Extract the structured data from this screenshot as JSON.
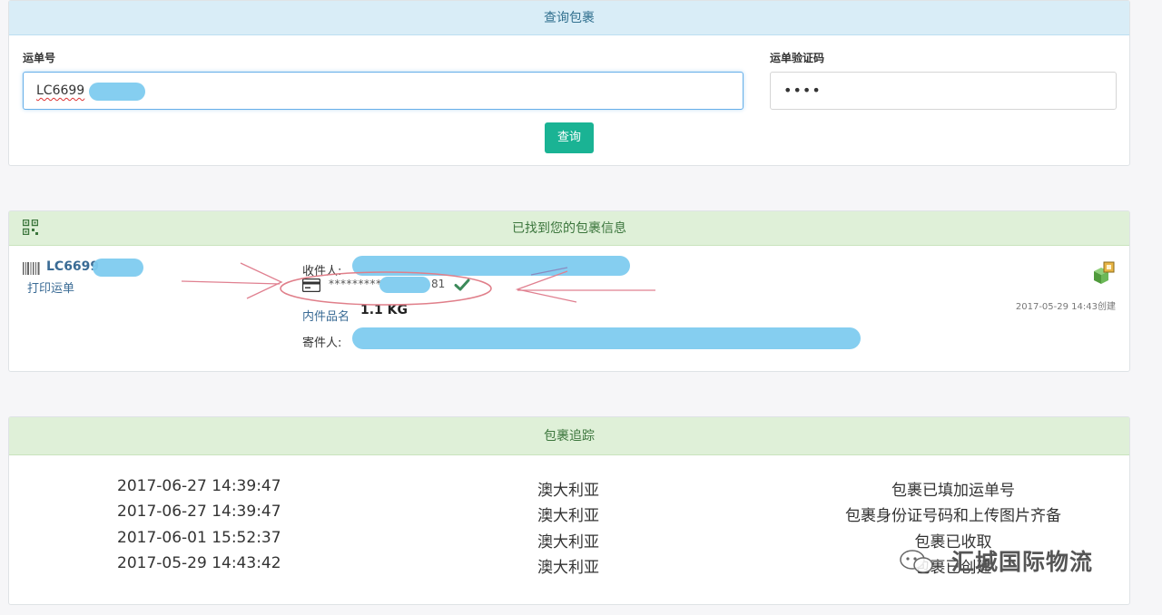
{
  "query_panel": {
    "title": "查询包裹",
    "waybill_label": "运单号",
    "waybill_value": "LC6699",
    "verify_label": "运单验证码",
    "verify_value": "••••",
    "query_button": "查询"
  },
  "result_panel": {
    "title": "已找到您的包裹信息",
    "waybill_no": "LC6699",
    "print_link": "打印运单",
    "receiver_label": "收件人:",
    "id_masked": "*********",
    "id_tail": "81",
    "contents_label": "内件品名",
    "weight": "1.1 KG",
    "sender_label": "寄件人:",
    "created_at": "2017-05-29 14:43创建",
    "icons": [
      "qr-code-icon",
      "barcode-icon",
      "id-card-icon",
      "check-icon",
      "package-icon"
    ]
  },
  "tracking_panel": {
    "title": "包裹追踪",
    "rows": [
      {
        "time": "2017-06-27 14:39:47",
        "location": "澳大利亚",
        "status": "包裹已填加运单号"
      },
      {
        "time": "2017-06-27 14:39:47",
        "location": "澳大利亚",
        "status": "包裹身份证号码和上传图片齐备"
      },
      {
        "time": "2017-06-01 15:52:37",
        "location": "澳大利亚",
        "status": "包裹已收取"
      },
      {
        "time": "2017-05-29 14:43:42",
        "location": "澳大利亚",
        "status": "包裹已创建"
      }
    ]
  },
  "watermark": "汇城国际物流",
  "colors": {
    "info_head": "#d9edf7",
    "success_head": "#dff0d8",
    "primary_button": "#1ab394",
    "link": "#3a6b95",
    "redaction": "#7ecbef"
  }
}
